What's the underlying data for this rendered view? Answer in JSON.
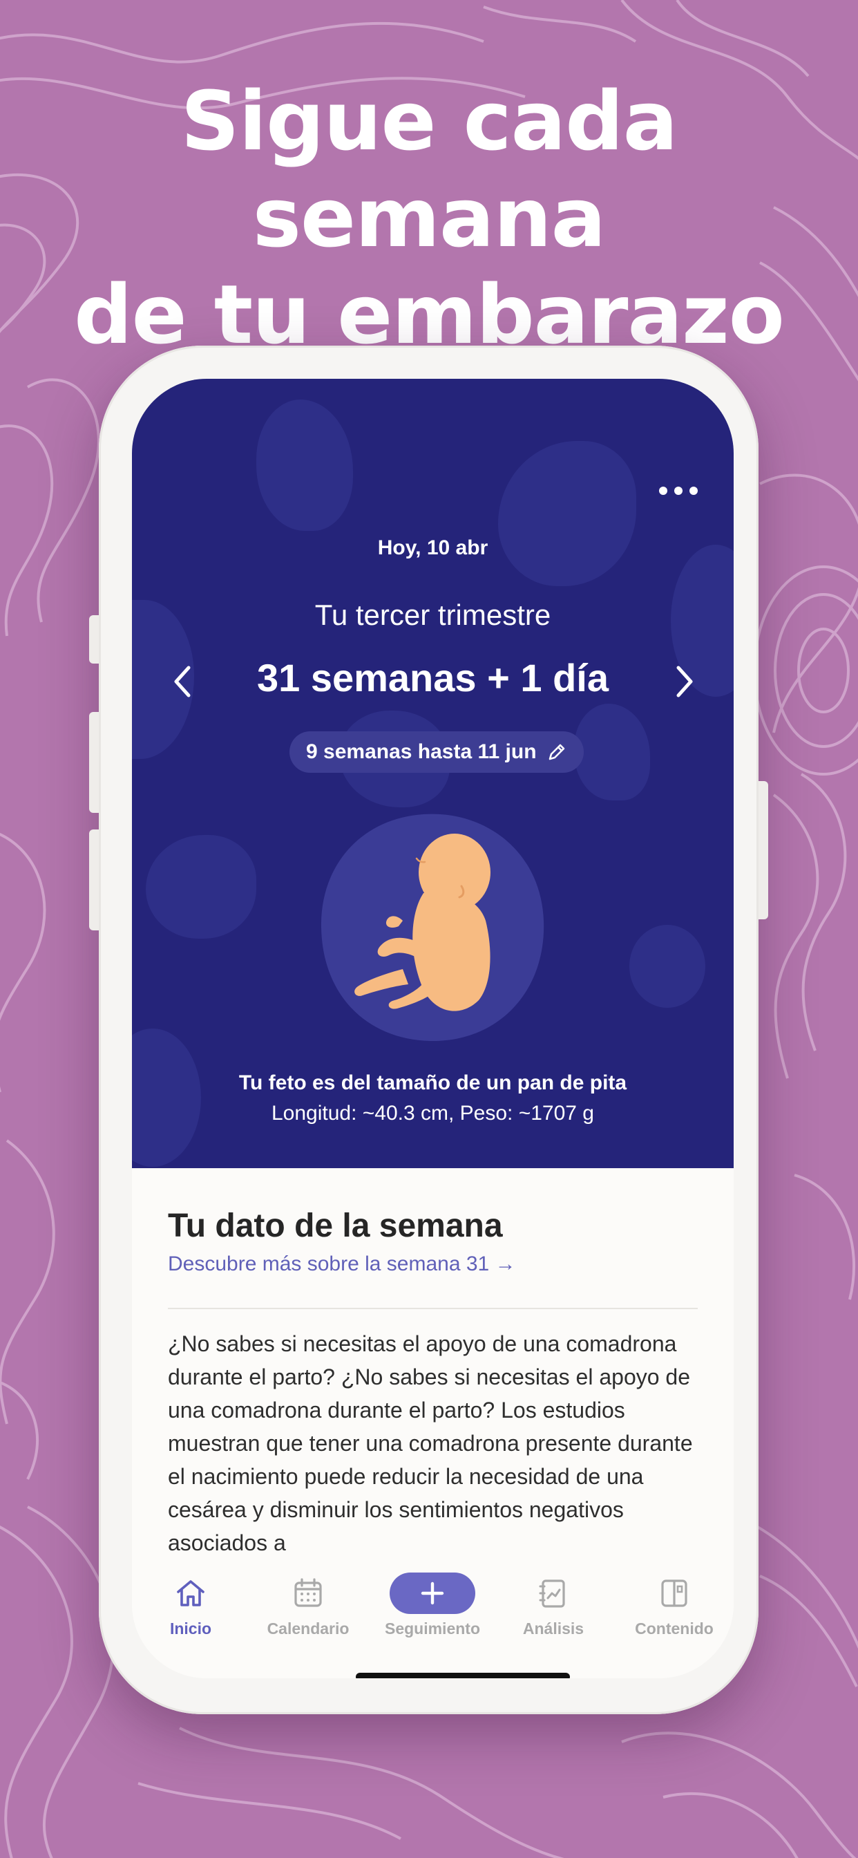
{
  "headline": {
    "line1": "Sigue cada semana",
    "line2": "de tu embarazo"
  },
  "colors": {
    "background": "#b376ad",
    "hero": "#25247a",
    "accent": "#6a68c4",
    "link": "#6060b8",
    "fetus": "#f7bb82"
  },
  "hero": {
    "menu_icon": "more-horizontal-icon",
    "date": "Hoy, 10 abr",
    "trimester": "Tu tercer trimestre",
    "weeks": "31 semanas + 1 día",
    "prev_icon": "chevron-left-icon",
    "next_icon": "chevron-right-icon",
    "due_pill": "9 semanas hasta 11 jun",
    "due_edit_icon": "pencil-icon",
    "size_text": "Tu feto es del tamaño de un pan de pita",
    "measure_text": "Longitud: ~40.3 cm, Peso: ~1707 g"
  },
  "fact": {
    "title": "Tu dato de la semana",
    "link": "Descubre más sobre la semana 31 →",
    "body": "¿No sabes si necesitas el apoyo de una comadrona durante el parto? ¿No sabes si necesitas el apoyo de una comadrona durante el parto? Los estudios muestran que tener una comadrona presente durante el nacimiento puede reducir la necesidad de una cesárea y disminuir los sentimientos negativos asociados a"
  },
  "tabs": [
    {
      "label": "Inicio",
      "icon": "home-icon",
      "active": true
    },
    {
      "label": "Calendario",
      "icon": "calendar-icon",
      "active": false
    },
    {
      "label": "Seguimiento",
      "icon": "plus-icon",
      "active": false
    },
    {
      "label": "Análisis",
      "icon": "analytics-icon",
      "active": false
    },
    {
      "label": "Contenido",
      "icon": "book-icon",
      "active": false
    }
  ]
}
